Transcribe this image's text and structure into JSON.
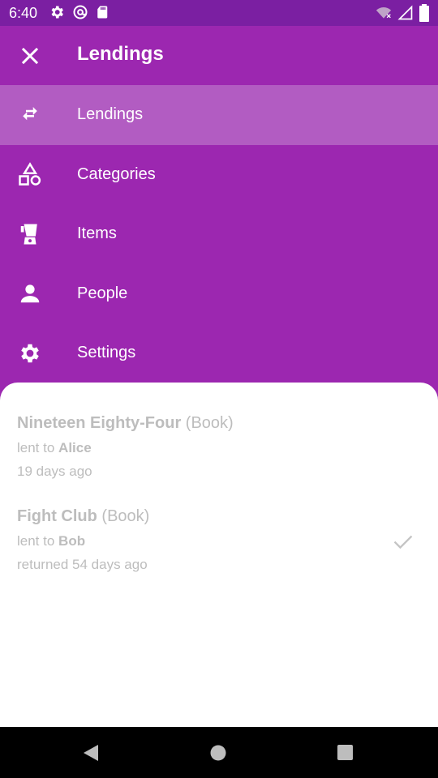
{
  "status": {
    "time": "6:40",
    "icons_left": [
      "gear-icon",
      "at-icon",
      "sdcard-icon"
    ],
    "icons_right": [
      "wifi-icon",
      "signal-icon",
      "battery-icon"
    ]
  },
  "appbar": {
    "title": "Lendings",
    "close_icon": "close-icon"
  },
  "menu": {
    "items": [
      {
        "label": "Lendings",
        "icon": "swap-arrows-icon",
        "active": true
      },
      {
        "label": "Categories",
        "icon": "shapes-icon",
        "active": false
      },
      {
        "label": "Items",
        "icon": "blender-icon",
        "active": false
      },
      {
        "label": "People",
        "icon": "person-icon",
        "active": false
      },
      {
        "label": "Settings",
        "icon": "gear-icon",
        "active": false
      }
    ]
  },
  "lendings": [
    {
      "item": "Nineteen Eighty-Four",
      "category": "(Book)",
      "lent_prefix": "lent to",
      "person": "Alice",
      "time": "19 days ago",
      "returned": false
    },
    {
      "item": "Fight Club",
      "category": "(Book)",
      "lent_prefix": "lent to",
      "person": "Bob",
      "time": "returned 54 days ago",
      "returned": true
    }
  ],
  "colors": {
    "primary": "#9c27b0",
    "status_bar": "#7b1fa2",
    "active_item": "#b25cc2",
    "faded_text": "#bdbdbd"
  }
}
